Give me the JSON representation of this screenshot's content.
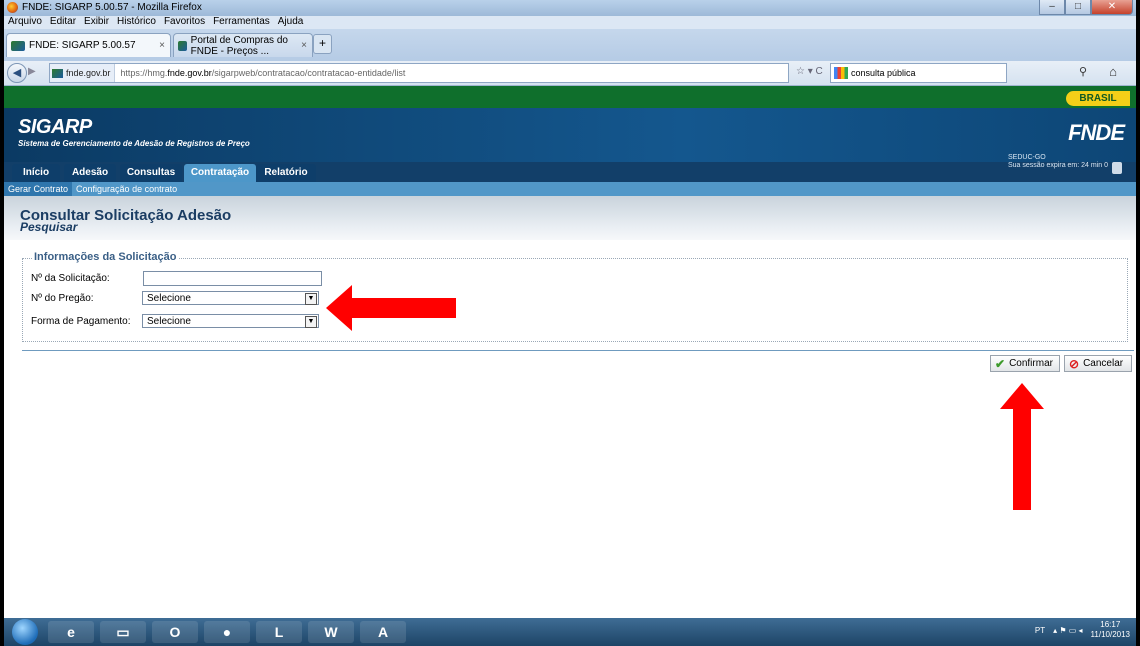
{
  "window": {
    "title": "FNDE: SIGARP 5.00.57 - Mozilla Firefox"
  },
  "menu": [
    "Arquivo",
    "Editar",
    "Exibir",
    "Histórico",
    "Favoritos",
    "Ferramentas",
    "Ajuda"
  ],
  "tabs": [
    {
      "label": "FNDE: SIGARP 5.00.57"
    },
    {
      "label": "Portal de Compras do FNDE - Preços ..."
    }
  ],
  "newtab": "+",
  "address": {
    "site": "fnde.gov.br",
    "url_pre": "https://hmg.",
    "url_host": "fnde.gov.br",
    "url_post": "/sigarpweb/contratacao/contratacao-entidade/list"
  },
  "search": {
    "value": "consulta pública"
  },
  "gov": {
    "brasil": "BRASIL"
  },
  "header": {
    "app": "SIGARP",
    "subtitle": "Sistema de Gerenciamento de Adesão de Registros de Preço",
    "logo": "FNDE"
  },
  "nav": {
    "tabs": [
      "Início",
      "Adesão",
      "Consultas",
      "Contratação",
      "Relatório"
    ],
    "active": "Contratação"
  },
  "user": {
    "name": "SEDUC-GO",
    "session": "Sua sessão expira em: 24 min 0"
  },
  "submenu": [
    "Gerar Contrato",
    "Configuração de contrato"
  ],
  "page": {
    "title": "Consultar Solicitação Adesão",
    "subtitle": "Pesquisar"
  },
  "form": {
    "legend": "Informações da Solicitação",
    "fields": [
      {
        "label": "Nº da Solicitação:",
        "value": ""
      },
      {
        "label": "Nº do Pregão:",
        "value": "Selecione"
      },
      {
        "label": "Forma de Pagamento:",
        "value": "Selecione"
      }
    ]
  },
  "buttons": {
    "confirm": "Confirmar",
    "cancel": "Cancelar"
  },
  "taskbar": {
    "lang": "PT",
    "time": "16:17",
    "date": "11/10/2013",
    "apps": [
      "ie-icon",
      "explorer-icon",
      "outlook-icon",
      "firefox-icon",
      "lync-icon",
      "word-icon",
      "acrobat-icon"
    ]
  },
  "colors": {
    "gov_green": "#0f6f2c",
    "header_blue": "#14578e",
    "active_tab": "#4d97c9",
    "arrow": "#ff0000"
  }
}
